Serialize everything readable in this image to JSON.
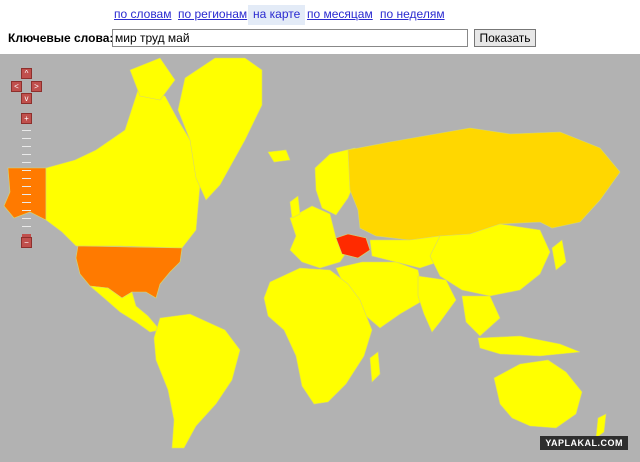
{
  "tabs": [
    {
      "label": "по словам",
      "active": false
    },
    {
      "label": "по регионам",
      "active": false
    },
    {
      "label": "на карте",
      "active": true
    },
    {
      "label": "по месяцам",
      "active": false
    },
    {
      "label": "по неделям",
      "active": false
    }
  ],
  "search": {
    "label": "Ключевые слова:",
    "value": "мир труд май",
    "button_label": "Показать"
  },
  "map_controls": {
    "up_icon": "^",
    "left_icon": "<",
    "right_icon": ">",
    "down_icon": "v",
    "zoom_in": "+",
    "zoom_out": "−"
  },
  "colors": {
    "ocean": "#b2b2b2",
    "low": "#ffff00",
    "mid": "#ffd700",
    "high": "#ff7a00",
    "max": "#ff2a00"
  },
  "watermark": "YAPLAKAL.COM"
}
